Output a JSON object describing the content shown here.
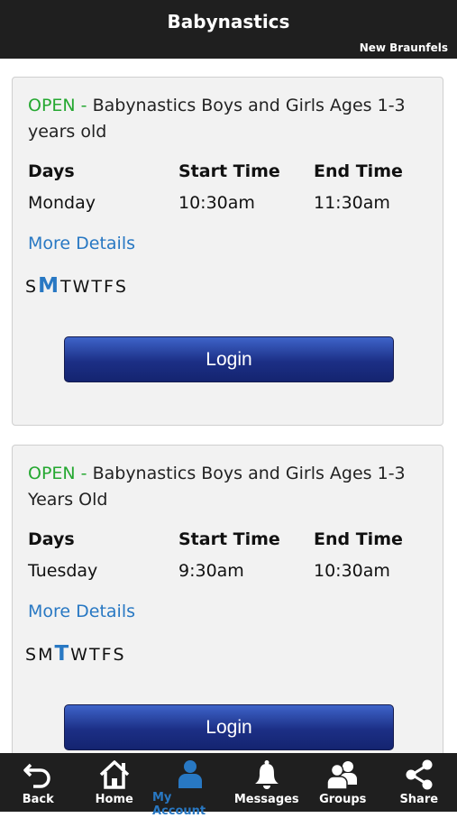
{
  "header": {
    "title": "Babynastics",
    "location": "New Braunfels"
  },
  "columns": {
    "days": "Days",
    "start": "Start Time",
    "end": "End Time"
  },
  "classes": [
    {
      "status": "OPEN - ",
      "name": "Babynastics Boys and Girls Ages 1-3 years old",
      "day": "Monday",
      "start": "10:30am",
      "end": "11:30am",
      "more": "More Details",
      "weekdays": [
        "S",
        "M",
        "T",
        "W",
        "T",
        "F",
        "S"
      ],
      "active_day": 1,
      "login": "Login"
    },
    {
      "status": "OPEN - ",
      "name": "Babynastics Boys and Girls Ages 1-3 Years Old",
      "day": "Tuesday",
      "start": "9:30am",
      "end": "10:30am",
      "more": "More Details",
      "weekdays": [
        "S",
        "M",
        "T",
        "W",
        "T",
        "F",
        "S"
      ],
      "active_day": 2,
      "login": "Login"
    }
  ],
  "tabs": [
    {
      "label": "Back",
      "icon": "back-icon"
    },
    {
      "label": "Home",
      "icon": "home-icon"
    },
    {
      "label": "My Account",
      "icon": "account-icon",
      "active": true
    },
    {
      "label": "Messages",
      "icon": "bell-icon"
    },
    {
      "label": "Groups",
      "icon": "groups-icon"
    },
    {
      "label": "Share",
      "icon": "share-icon"
    }
  ],
  "colors": {
    "accent": "#2878c3",
    "open": "#25a831",
    "bar": "#1f1f1f"
  }
}
